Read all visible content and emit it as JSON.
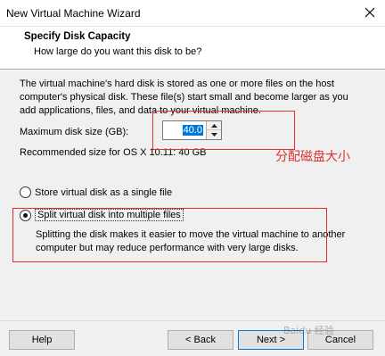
{
  "window": {
    "title": "New Virtual Machine Wizard",
    "close_icon": "close-icon"
  },
  "header": {
    "title": "Specify Disk Capacity",
    "subtitle": "How large do you want this disk to be?"
  },
  "content": {
    "description": "The virtual machine's hard disk is stored as one or more files on the host computer's physical disk. These file(s) start small and become larger as you add applications, files, and data to your virtual machine.",
    "max_disk_label": "Maximum disk size (GB):",
    "max_disk_value": "40.0",
    "recommended": "Recommended size for OS X 10.11: 40 GB",
    "annotation": "分配磁盘大小",
    "annotation_color": "#e03030",
    "options": [
      {
        "label": "Store virtual disk as a single file",
        "selected": false
      },
      {
        "label": "Split virtual disk into multiple files",
        "selected": true
      }
    ],
    "split_description": "Splitting the disk makes it easier to move the virtual machine to another computer but may reduce performance with very large disks."
  },
  "footer": {
    "help": "Help",
    "back": "< Back",
    "next": "Next >",
    "cancel": "Cancel",
    "watermark": "Baidu 经验"
  }
}
